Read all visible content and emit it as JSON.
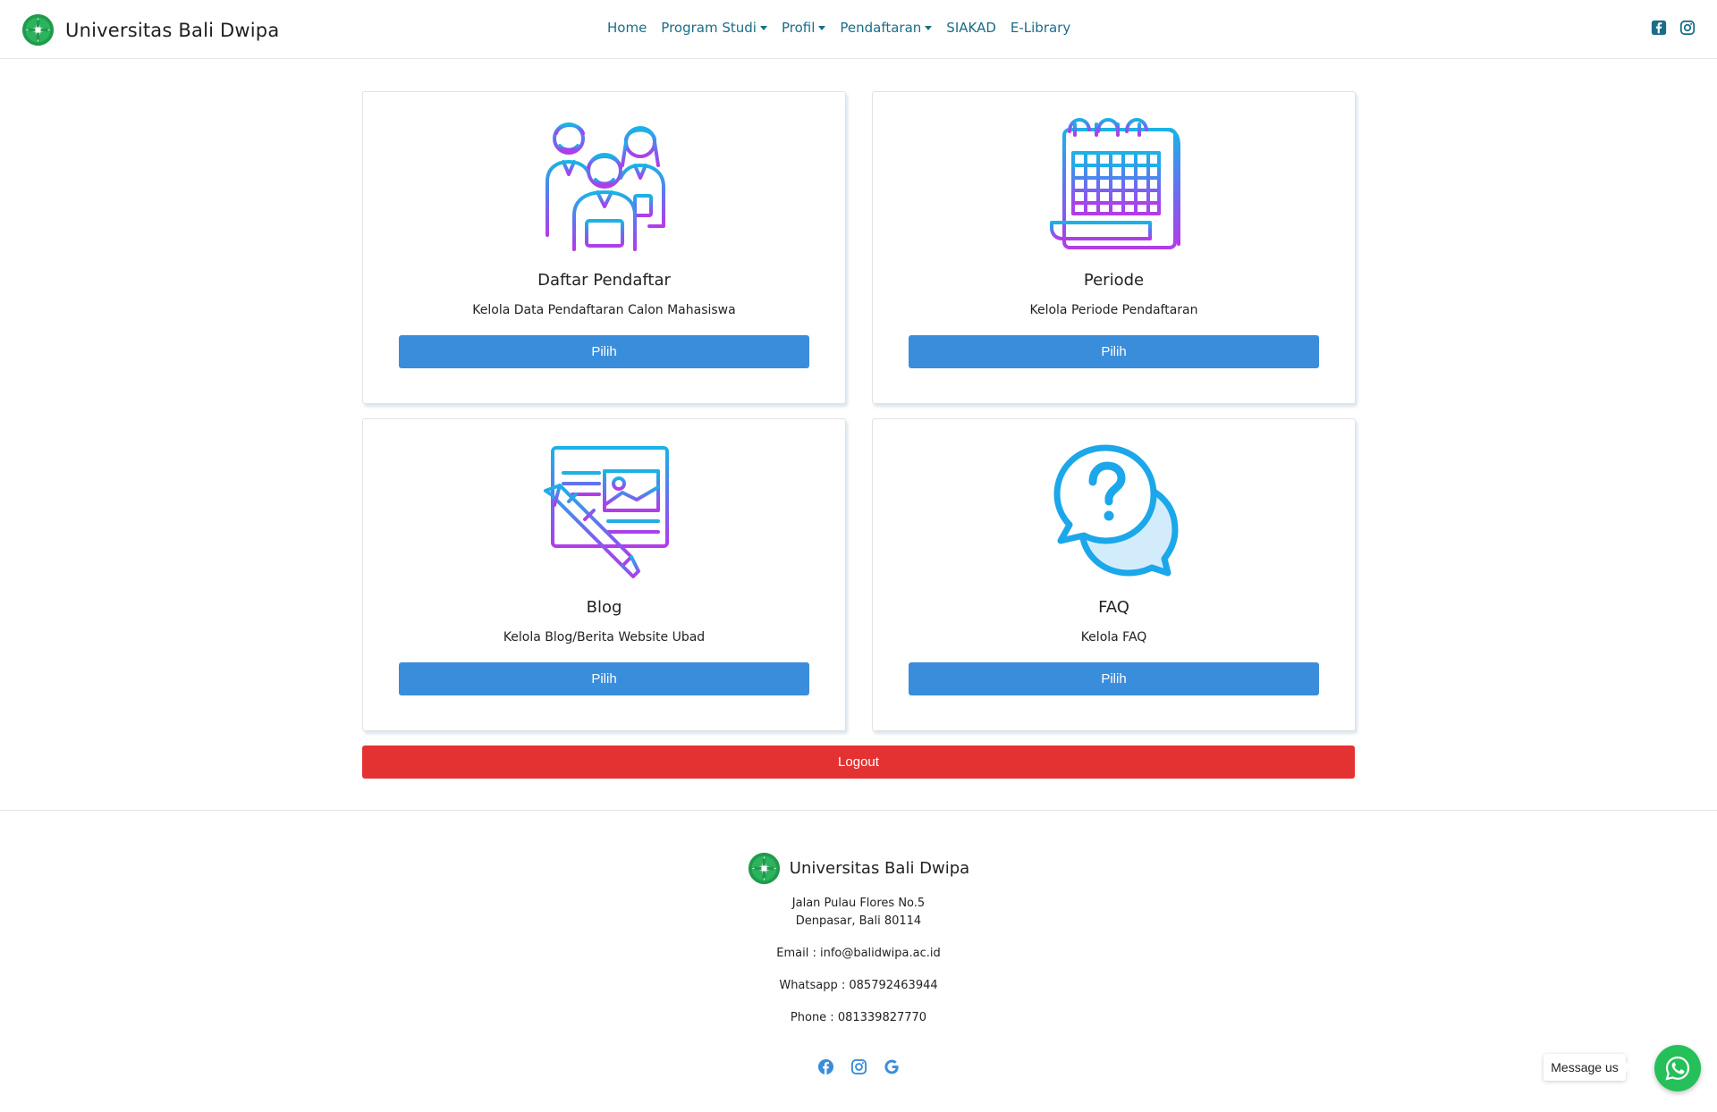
{
  "nav": {
    "brand": "Universitas Bali Dwipa",
    "links": [
      {
        "label": "Home",
        "dropdown": false
      },
      {
        "label": "Program Studi",
        "dropdown": true
      },
      {
        "label": "Profil",
        "dropdown": true
      },
      {
        "label": "Pendaftaran",
        "dropdown": true
      },
      {
        "label": "SIAKAD",
        "dropdown": false
      },
      {
        "label": "E-Library",
        "dropdown": false
      }
    ],
    "social": [
      "facebook-square-icon",
      "instagram-icon"
    ]
  },
  "cards": [
    {
      "title": "Daftar Pendaftar",
      "desc": "Kelola Data Pendaftaran Calon Mahasiswa",
      "button": "Pilih",
      "icon": "people-group-icon"
    },
    {
      "title": "Periode",
      "desc": "Kelola Periode Pendaftaran",
      "button": "Pilih",
      "icon": "calendar-icon"
    },
    {
      "title": "Blog",
      "desc": "Kelola Blog/Berita Website Ubad",
      "button": "Pilih",
      "icon": "blog-pen-icon"
    },
    {
      "title": "FAQ",
      "desc": "Kelola FAQ",
      "button": "Pilih",
      "icon": "faq-chat-icon"
    }
  ],
  "logout_label": "Logout",
  "footer": {
    "brand": "Universitas Bali Dwipa",
    "address1": "Jalan Pulau Flores No.5",
    "address2": "Denpasar, Bali 80114",
    "email": "Email : info@balidwipa.ac.id",
    "whatsapp": "Whatsapp : 085792463944",
    "phone": "Phone : 081339827770",
    "social": [
      "facebook-icon",
      "instagram-icon",
      "google-icon"
    ]
  },
  "chat": {
    "label": "Message us"
  },
  "colors": {
    "nav_link": "#1a6d88",
    "button_blue": "#3a8ddb",
    "button_red": "#e43232",
    "whatsapp_green": "#25c05a",
    "logo_green": "#1f9b4b"
  }
}
